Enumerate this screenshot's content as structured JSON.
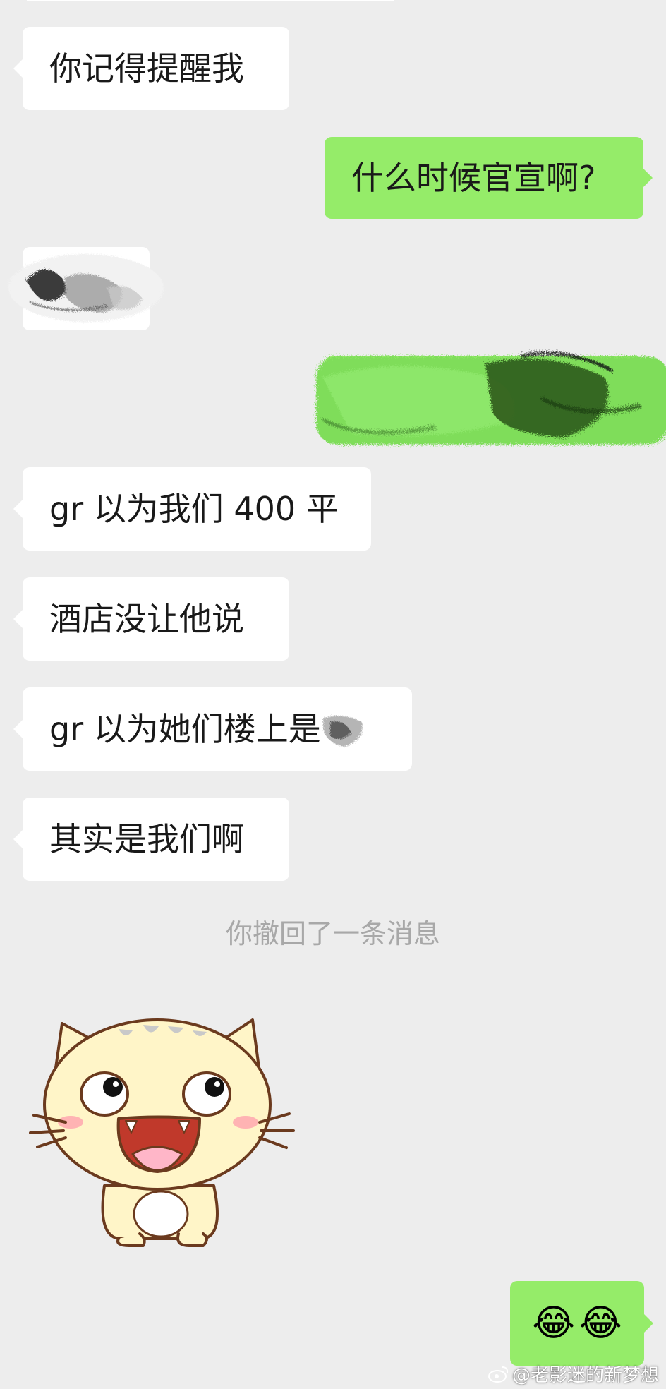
{
  "messages": [
    {
      "side": "left",
      "text": "你记得提醒我"
    },
    {
      "side": "right",
      "text": "什么时候官宣啊?"
    },
    {
      "side": "left",
      "text": "[redacted]"
    },
    {
      "side": "right",
      "text": "[redacted]"
    },
    {
      "side": "left",
      "text": "gr 以为我们 400 平"
    },
    {
      "side": "left",
      "text": "酒店没让他说"
    },
    {
      "side": "left",
      "text": "gr 以为她们楼上是"
    },
    {
      "side": "left",
      "text": "其实是我们啊"
    }
  ],
  "system_notice": "你撤回了一条消息",
  "sticker": {
    "name": "laughing-cat-sticker"
  },
  "last_message": {
    "side": "right",
    "emoji": [
      "😂",
      "😂"
    ]
  },
  "watermark": {
    "text": "@老影迷的新梦想",
    "icon": "weibo-icon"
  },
  "colors": {
    "background": "#ededed",
    "left_bubble": "#ffffff",
    "right_bubble": "#95ec69",
    "text": "#191919",
    "notice": "#a8a8a8"
  }
}
